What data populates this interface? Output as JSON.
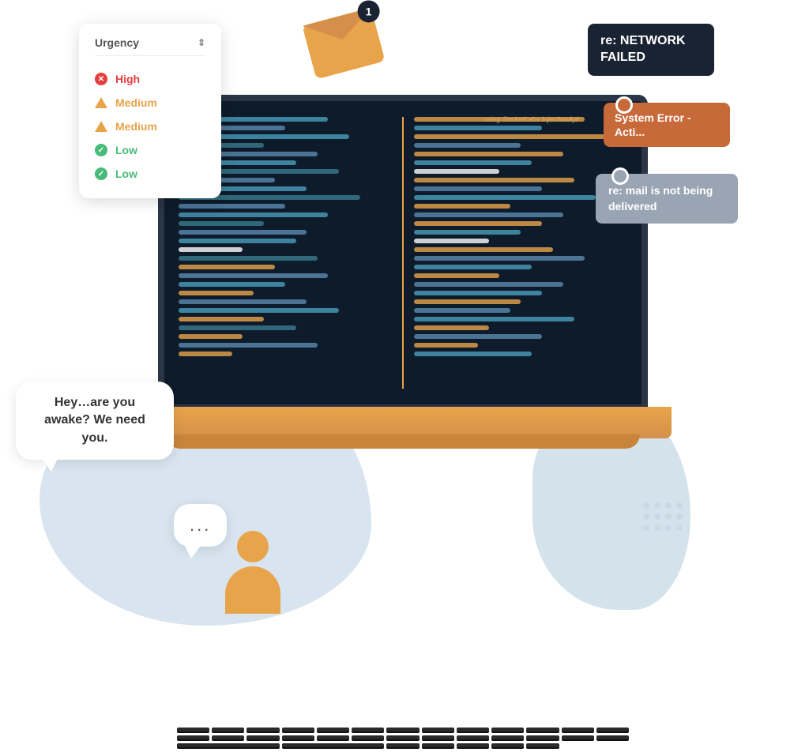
{
  "scene": {
    "urgency_widget": {
      "header": "Urgency",
      "sort_icon": "⇕",
      "items": [
        {
          "level": "High",
          "type": "error",
          "color": "red"
        },
        {
          "level": "Medium",
          "type": "warning",
          "color": "orange"
        },
        {
          "level": "Medium",
          "type": "warning",
          "color": "orange"
        },
        {
          "level": "Low",
          "type": "success",
          "color": "green"
        },
        {
          "level": "Low",
          "type": "success",
          "color": "green"
        }
      ]
    },
    "envelope": {
      "notification_count": "1"
    },
    "tags": {
      "network_failed": "re: NETWORK FAILED",
      "system_error": "System Error - Acti...",
      "mail_not_delivered": "re: mail is not being delivered"
    },
    "speech_bubbles": {
      "main_text": "Hey…are you awake? We need you.",
      "dots": "..."
    },
    "code_label": "using SocketLabs.InjectionApi"
  }
}
